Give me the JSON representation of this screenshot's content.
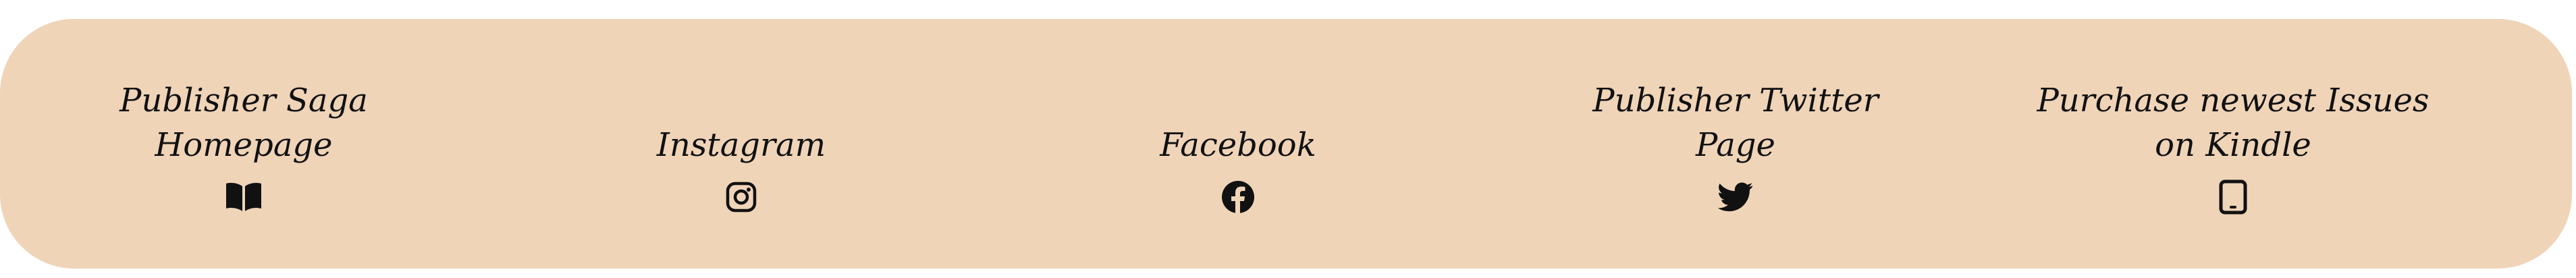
{
  "footer": {
    "background_color": "#f0d4b8",
    "text_color": "#111111",
    "links": [
      {
        "label": "Publisher Saga\nHomepage",
        "icon": "book-icon"
      },
      {
        "label": "Instagram",
        "icon": "instagram-icon"
      },
      {
        "label": "Facebook",
        "icon": "facebook-icon"
      },
      {
        "label": "Publisher Twitter\nPage",
        "icon": "twitter-icon"
      },
      {
        "label": "Purchase newest Issues\non Kindle",
        "icon": "tablet-icon"
      }
    ]
  }
}
